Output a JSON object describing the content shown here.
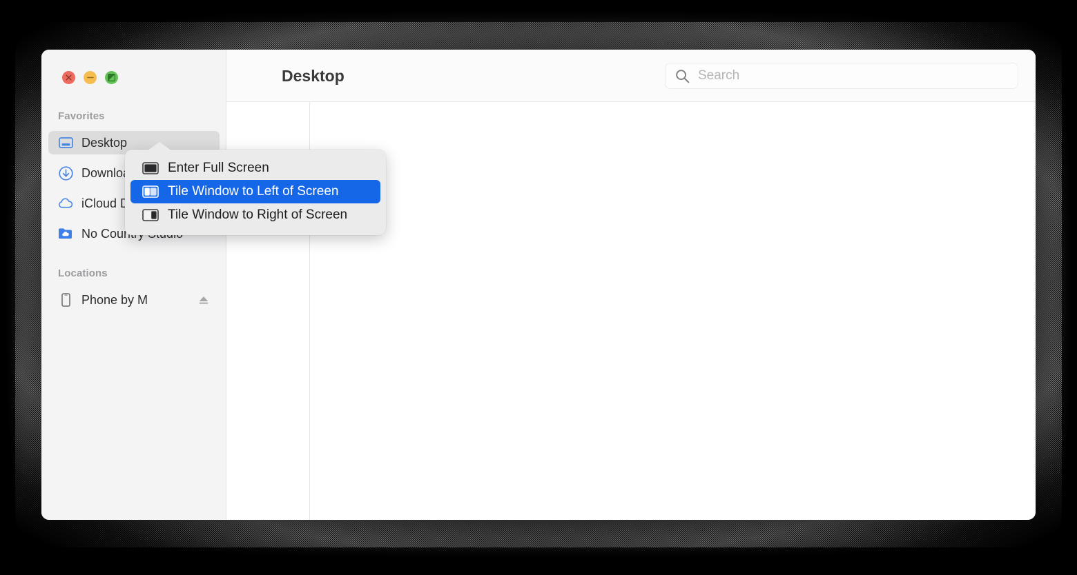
{
  "window": {
    "title": "Desktop",
    "traffic_lights": [
      {
        "name": "close",
        "color": "#ed6a5e",
        "glyph": "close-icon"
      },
      {
        "name": "minimize",
        "color": "#f5bd4f",
        "glyph": "minus-icon"
      },
      {
        "name": "maximize",
        "color": "#61c454",
        "glyph": "tile-split-icon"
      }
    ]
  },
  "search": {
    "placeholder": "Search",
    "value": "",
    "icon": "search-icon"
  },
  "sidebar": {
    "sections": [
      {
        "label": "Favorites",
        "items": [
          {
            "label": "Desktop",
            "icon": "desktop-icon",
            "selected": true
          },
          {
            "label": "Downloads",
            "icon": "downloads-icon",
            "selected": false
          },
          {
            "label": "iCloud Drive",
            "icon": "icloud-icon",
            "selected": false
          },
          {
            "label": "No Country Studio",
            "icon": "folder-icloud-icon",
            "selected": false
          }
        ]
      },
      {
        "label": "Locations",
        "items": [
          {
            "label": "Phone by M",
            "icon": "phone-icon",
            "selected": false,
            "eject": "eject-icon"
          }
        ]
      }
    ]
  },
  "context_menu": {
    "items": [
      {
        "label": "Enter Full Screen",
        "icon": "fullscreen-icon",
        "highlighted": false
      },
      {
        "label": "Tile Window to Left of Screen",
        "icon": "tile-left-icon",
        "highlighted": true
      },
      {
        "label": "Tile Window to Right of Screen",
        "icon": "tile-right-icon",
        "highlighted": false
      }
    ],
    "highlight_color": "#1667e8"
  },
  "colors": {
    "sidebar_bg": "#f4f4f5",
    "content_bg": "#ffffff",
    "selection_bg": "#dcdcdd",
    "accent_blue": "#1667e8",
    "sidebar_icon_blue": "#3f7fe8"
  }
}
